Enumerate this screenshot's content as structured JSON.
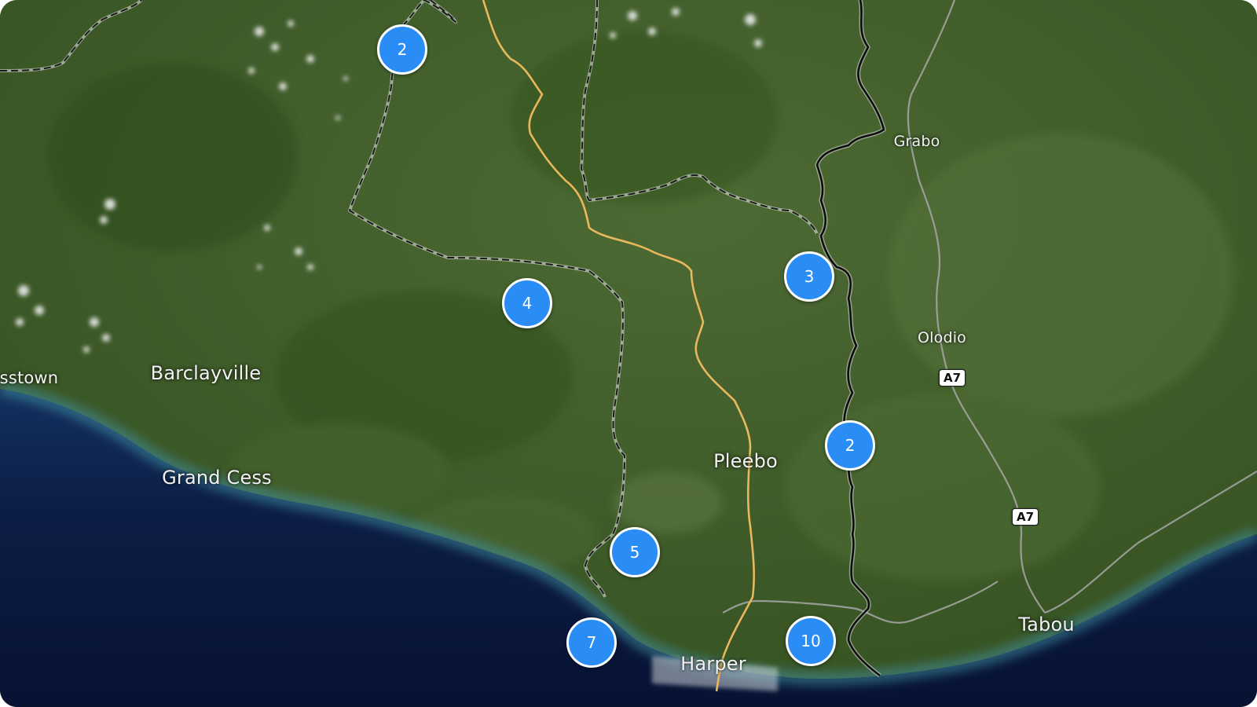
{
  "places": [
    {
      "name": "Barclayville",
      "size": "large"
    },
    {
      "name": "Grand Cess",
      "size": "large"
    },
    {
      "name": "sstown",
      "size": "medium"
    },
    {
      "name": "Pleebo",
      "size": "large"
    },
    {
      "name": "Harper",
      "size": "large"
    },
    {
      "name": "Grabo",
      "size": "small"
    },
    {
      "name": "Olodio",
      "size": "small"
    },
    {
      "name": "Tabou",
      "size": "large"
    }
  ],
  "road_shields": [
    "A7",
    "A7"
  ],
  "clusters": [
    {
      "count": "2"
    },
    {
      "count": "4"
    },
    {
      "count": "3"
    },
    {
      "count": "2"
    },
    {
      "count": "5"
    },
    {
      "count": "7"
    },
    {
      "count": "10"
    }
  ],
  "colors": {
    "cluster_fill": "#2a8cf5",
    "cluster_border": "#ffffff",
    "ocean": "#0d1c3f",
    "land": "#3f5f2a",
    "road_highlight": "#e9b85c"
  },
  "icons": {
    "cluster": "cluster-marker-icon"
  }
}
